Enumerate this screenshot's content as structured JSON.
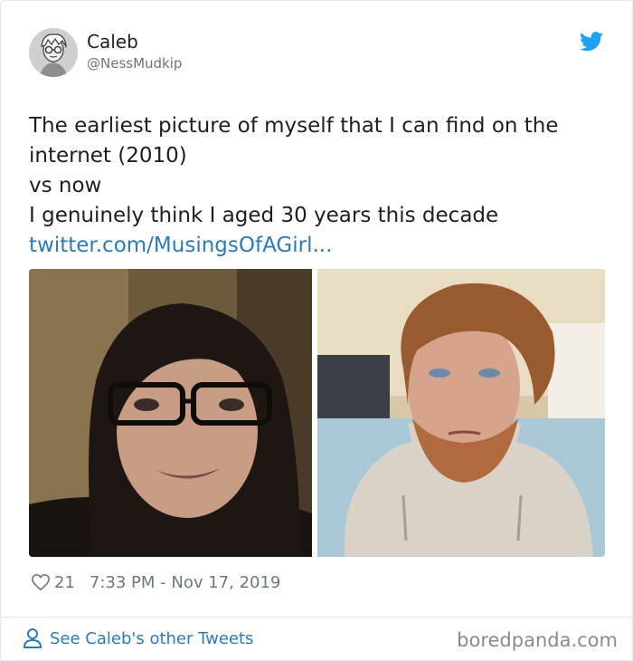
{
  "tweet": {
    "author_name": "Caleb",
    "author_handle": "@NessMudkip",
    "text_lines": [
      "The earliest picture of myself that I can find on the",
      "internet (2010)",
      "vs now",
      "I genuinely think I aged 30 years this decade"
    ],
    "link_text": "twitter.com/MusingsOfAGirl...",
    "likes": "21",
    "timestamp": "7:33 PM - Nov 17, 2019"
  },
  "footer": {
    "other_tweets_label": "See Caleb's other Tweets",
    "watermark": "boredpanda.com"
  },
  "icons": {
    "bird": "twitter-bird-icon",
    "heart": "heart-icon",
    "person": "person-icon"
  },
  "colors": {
    "link": "#2b7bb9",
    "muted": "#697882",
    "text": "#1c2022",
    "border": "#e1e8ed",
    "twitter_blue": "#1da1f2"
  }
}
